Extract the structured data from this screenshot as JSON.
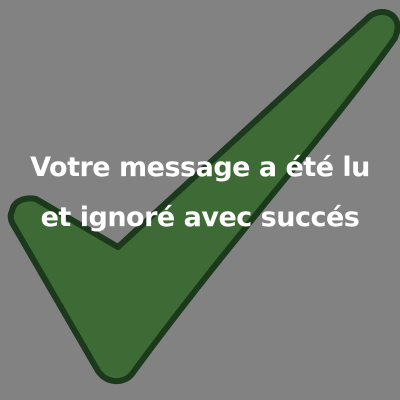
{
  "caption": {
    "line1": "Votre message a été lu",
    "line2": "et ignoré avec succés"
  },
  "icon": "checkmark-icon",
  "colors": {
    "background": "#828282",
    "check_fill": "#3e6a36",
    "check_outline": "#1b3a1c",
    "text": "#ffffff"
  }
}
